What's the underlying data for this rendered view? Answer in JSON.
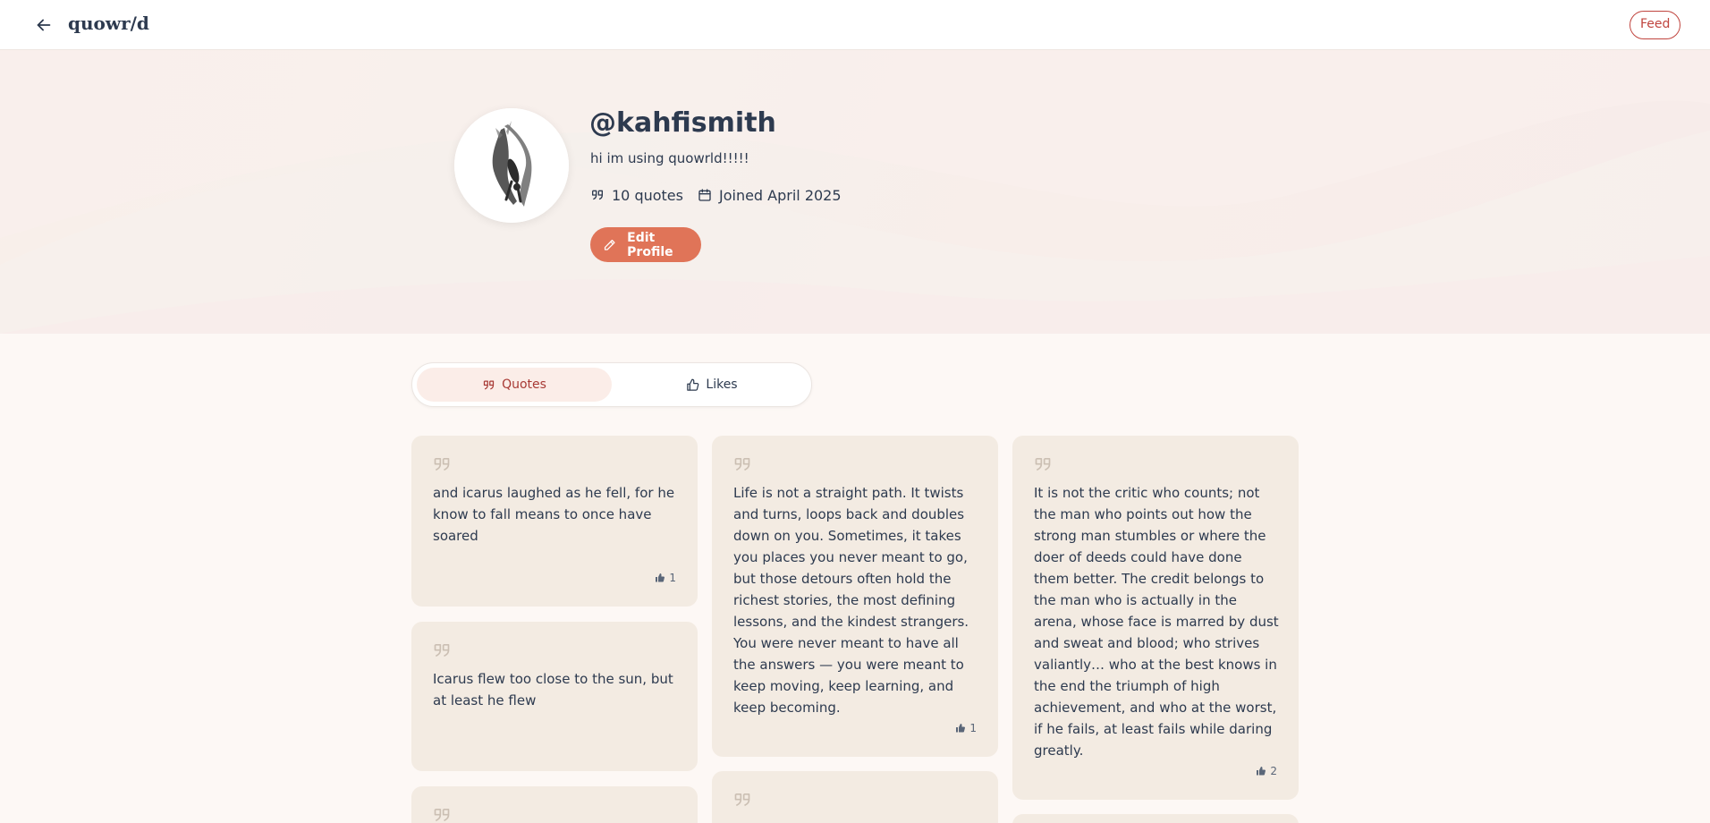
{
  "header": {
    "brand": "quowr/d",
    "feed_label": "Feed"
  },
  "profile": {
    "handle": "@kahfismith",
    "bio": "hi im using quowrld!!!!!",
    "quotes_count": "10 quotes",
    "joined": "Joined April 2025",
    "edit_label": "Edit Profile"
  },
  "tabs": {
    "quotes": "Quotes",
    "likes": "Likes",
    "active": "quotes"
  },
  "quotes": [
    {
      "text": "and icarus laughed as he fell, for he know to fall means to once have soared",
      "likes": "1"
    },
    {
      "text": "Icarus flew too close to the sun, but at least he flew",
      "likes": ""
    },
    {
      "text": "Life is not a straight path. It twists and turns, loops back and doubles down on you. Sometimes, it takes you places you never meant to go, but those detours often hold the richest stories, the most defining lessons, and the kindest strangers. You were never meant to have all the answers — you were meant to keep moving, keep learning, and keep becoming.",
      "likes": "1"
    },
    {
      "text": "It is not the critic who counts; not the man who points out how the strong man stumbles or where the doer of deeds could have done them better. The credit belongs to the man who is actually in the arena, whose face is marred by dust and sweat and blood; who strives valiantly… who at the best knows in the end the triumph of high achievement, and who at the worst, if he fails, at least fails while daring greatly.",
      "likes": "2"
    }
  ],
  "icons": {
    "back": "arrow-left-icon",
    "quote": "quote-icon",
    "calendar": "calendar-icon",
    "pencil": "pencil-icon",
    "thumbs_up": "thumbs-up-icon"
  },
  "colors": {
    "accent": "#e07458",
    "brand_red": "#c0443e",
    "card_bg": "#f3ebe2",
    "text": "#2d3a4f"
  }
}
